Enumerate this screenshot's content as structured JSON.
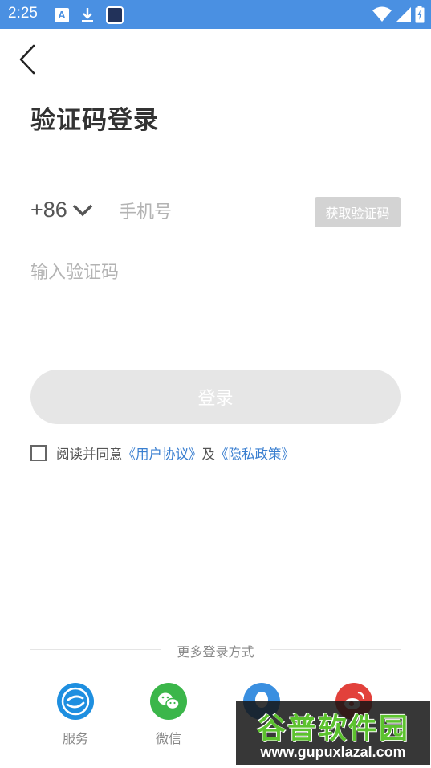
{
  "status_bar": {
    "time": "2:25",
    "notification_a": "A",
    "icons": [
      "a-notification-icon",
      "download-icon",
      "app-icon",
      "wifi-icon",
      "signal-icon",
      "battery-icon"
    ]
  },
  "header": {
    "title": "验证码登录"
  },
  "phone": {
    "country_code": "+86",
    "placeholder": "手机号",
    "get_code_label": "获取验证码"
  },
  "code": {
    "placeholder": "输入验证码"
  },
  "login": {
    "label": "登录"
  },
  "agreement": {
    "prefix": "阅读并同意",
    "user_agreement": "《用户协议》",
    "and": "及",
    "privacy_policy": "《隐私政策》"
  },
  "more_login": {
    "label": "更多登录方式",
    "options": [
      {
        "label": "服务",
        "color": "#1e8fe0",
        "icon": "service-logo-icon"
      },
      {
        "label": "微信",
        "color": "#3bb64a",
        "icon": "wechat-icon"
      },
      {
        "label": "",
        "color": "#3a8fe0",
        "icon": "qq-icon"
      },
      {
        "label": "",
        "color": "#e2413b",
        "icon": "weibo-icon"
      }
    ]
  },
  "watermark": {
    "title": "谷普软件园",
    "url": "www.gupuxlazal.com"
  },
  "colors": {
    "status_bar": "#4a90e2",
    "link": "#3a7fd0",
    "button_disabled": "#e6e6e6",
    "get_code_disabled": "#d3d3d3"
  }
}
